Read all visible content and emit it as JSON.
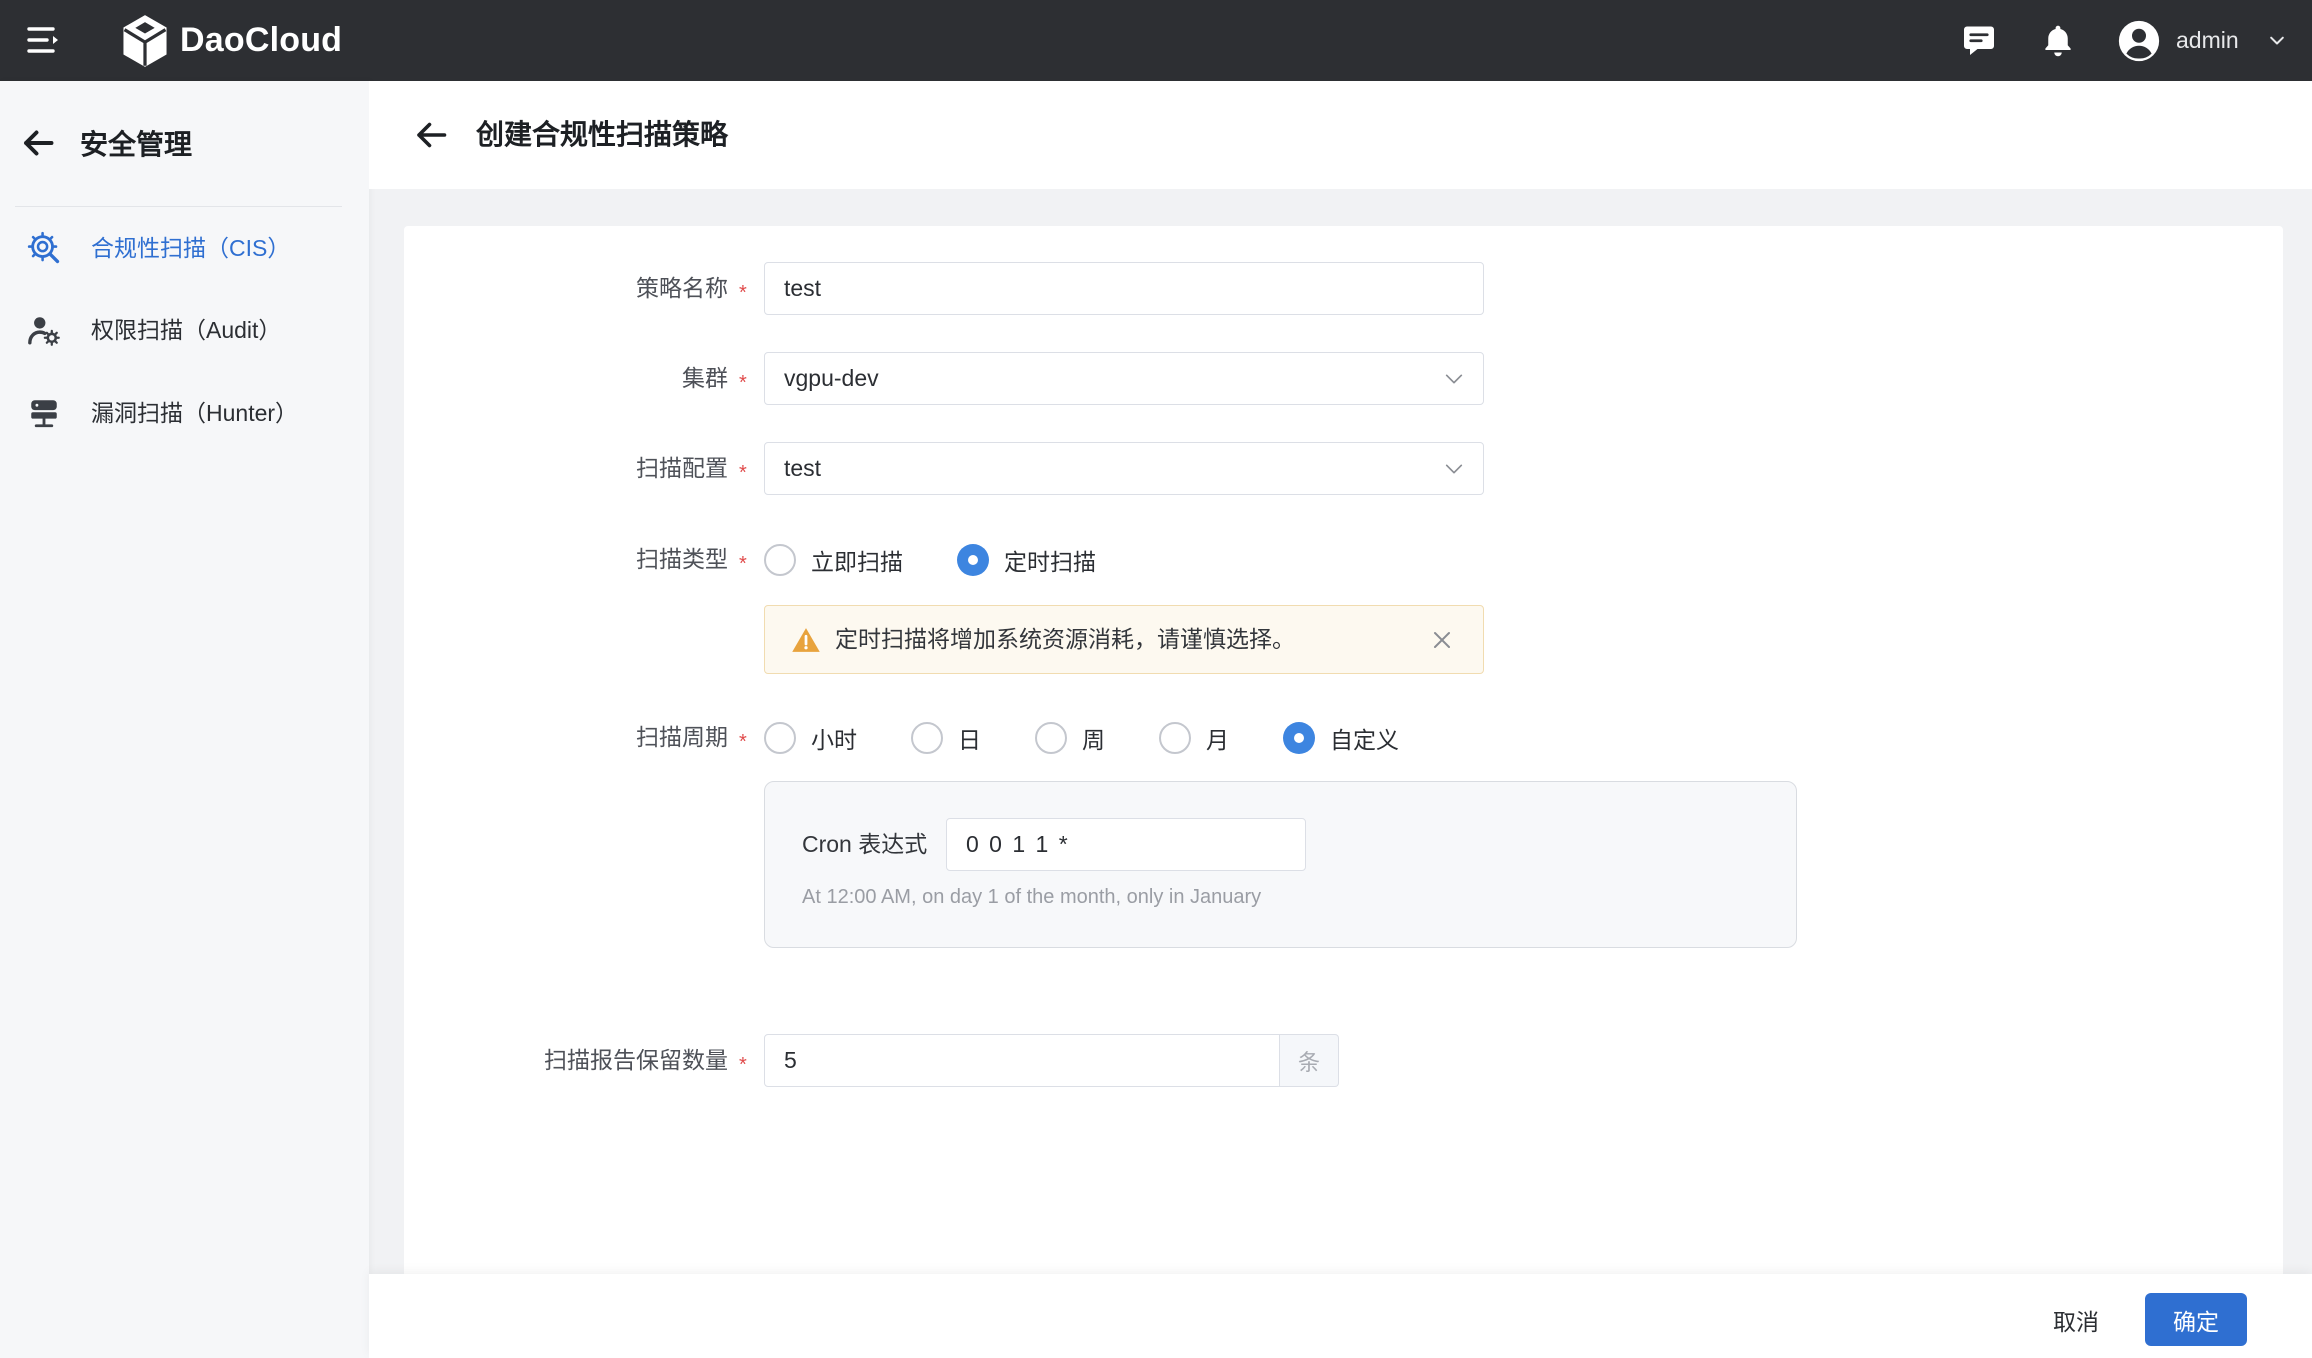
{
  "topbar": {
    "brand": "DaoCloud",
    "user_name": "admin",
    "icons": {
      "menu": "hamburger-icon",
      "logo": "daocloud-logo-icon",
      "messages": "message-icon",
      "notifications": "bell-icon",
      "avatar": "user-avatar-icon",
      "user_menu": "chevron-down-icon"
    }
  },
  "sidebar": {
    "back_icon": "arrow-left-icon",
    "title": "安全管理",
    "items": [
      {
        "label": "合规性扫描（CIS）",
        "icon": "compliance-scan-icon",
        "active": true
      },
      {
        "label": "权限扫描（Audit）",
        "icon": "permission-scan-icon",
        "active": false
      },
      {
        "label": "漏洞扫描（Hunter）",
        "icon": "vulnerability-scan-icon",
        "active": false
      }
    ]
  },
  "header": {
    "back_icon": "arrow-left-icon",
    "title": "创建合规性扫描策略"
  },
  "form": {
    "required_mark": "*",
    "policy_name": {
      "label": "策略名称",
      "value": "test"
    },
    "cluster": {
      "label": "集群",
      "value": "vgpu-dev"
    },
    "scan_config": {
      "label": "扫描配置",
      "value": "test"
    },
    "scan_type": {
      "label": "扫描类型",
      "options": [
        {
          "label": "立即扫描",
          "checked": false
        },
        {
          "label": "定时扫描",
          "checked": true
        }
      ]
    },
    "scan_type_alert": {
      "icon": "warning-icon",
      "text": "定时扫描将增加系统资源消耗，请谨慎选择。",
      "close_icon": "close-icon"
    },
    "scan_cycle": {
      "label": "扫描周期",
      "options": [
        {
          "label": "小时",
          "checked": false
        },
        {
          "label": "日",
          "checked": false
        },
        {
          "label": "周",
          "checked": false
        },
        {
          "label": "月",
          "checked": false
        },
        {
          "label": "自定义",
          "checked": true
        }
      ]
    },
    "cron": {
      "label": "Cron 表达式",
      "value": "0 0 1 1 *",
      "description": "At 12:00 AM, on day 1 of the month, only in January"
    },
    "report_retention": {
      "label": "扫描报告保留数量",
      "value": "5",
      "unit": "条"
    }
  },
  "footer": {
    "cancel_label": "取消",
    "confirm_label": "确定"
  },
  "colors": {
    "topbar_bg": "#2d2f33",
    "accent": "#2f6fd1",
    "radio_checked": "#3d85e0",
    "required": "#e04b4b",
    "warning": "#e8a33d"
  }
}
